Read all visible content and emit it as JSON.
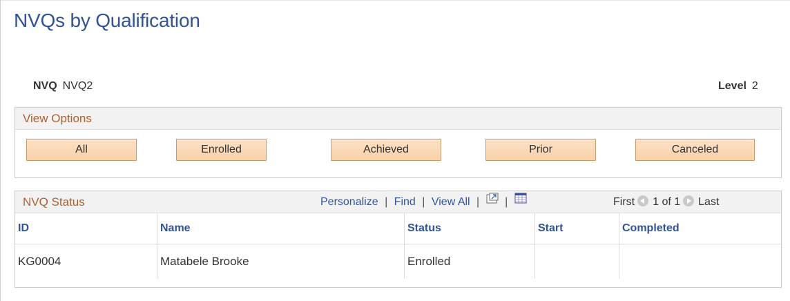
{
  "page": {
    "title": "NVQs by Qualification"
  },
  "fields": {
    "nvq_label": "NVQ",
    "nvq_value": "NVQ2",
    "level_label": "Level",
    "level_value": "2"
  },
  "view_options": {
    "title": "View Options",
    "buttons": [
      "All",
      "Enrolled",
      "Achieved",
      "Prior",
      "Canceled"
    ]
  },
  "nvq_status": {
    "title": "NVQ Status",
    "toolbar": {
      "personalize": "Personalize",
      "find": "Find",
      "view_all": "View All",
      "sep": "|"
    },
    "nav": {
      "first": "First",
      "range": "1 of 1",
      "last": "Last"
    },
    "icons": [
      "zoom-icon",
      "download-icon",
      "arrow-left-icon",
      "arrow-right-icon"
    ],
    "columns": [
      "ID",
      "Name",
      "Status",
      "Start",
      "Completed"
    ],
    "rows": [
      {
        "id": "KG0004",
        "name": "Matabele Brooke",
        "status": "Enrolled",
        "start": "",
        "completed": ""
      }
    ]
  }
}
